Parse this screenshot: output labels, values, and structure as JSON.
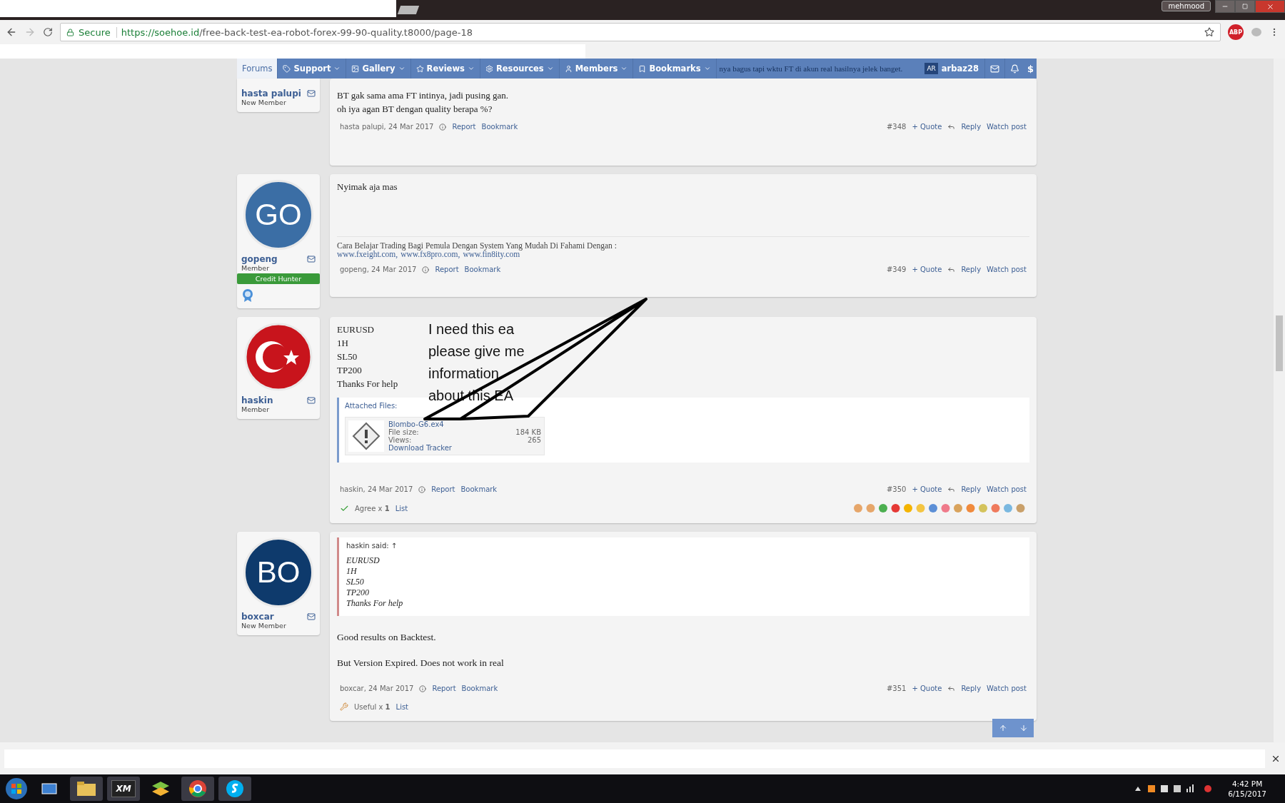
{
  "browser": {
    "profile": "mehmood",
    "secure_label": "Secure",
    "url_host": "https://soehoe.id",
    "url_path": "/free-back-test-ea-robot-forex-99-90-quality.t8000/page-18",
    "abp_label": "ABP"
  },
  "nav": {
    "items": [
      {
        "label": "Forums",
        "selected": true,
        "dropdown": false
      },
      {
        "label": "Support",
        "selected": false,
        "dropdown": true
      },
      {
        "label": "Gallery",
        "selected": false,
        "dropdown": true
      },
      {
        "label": "Reviews",
        "selected": false,
        "dropdown": true
      },
      {
        "label": "Resources",
        "selected": false,
        "dropdown": true
      },
      {
        "label": "Members",
        "selected": false,
        "dropdown": true
      },
      {
        "label": "Bookmarks",
        "selected": false,
        "dropdown": true
      }
    ],
    "behind_text": "nya bagus tapi wktu FT di akun real hasilnya jelek banget.",
    "user_initials": "AR",
    "user_name": "arbaz28",
    "cut_label": "$"
  },
  "posts": [
    {
      "author": "hasta palupi",
      "title": "New Member",
      "body": [
        "BT gak sama ama FT intinya, jadi pusing gan.",
        "oh iya agan BT dengan quality berapa %?"
      ],
      "meta": {
        "byline": "hasta palupi, 24 Mar 2017",
        "report": "Report",
        "bookmark": "Bookmark",
        "number": "#348",
        "quote": "+ Quote",
        "reply": "Reply",
        "watch": "Watch post"
      }
    },
    {
      "author": "gopeng",
      "title": "Member",
      "avatar": {
        "kind": "initials",
        "initials": "GO",
        "color": "#3b6ea5"
      },
      "badge": "Credit Hunter",
      "trophy": true,
      "body": [
        "Nyimak aja mas"
      ],
      "signature": {
        "text": "Cara Belajar Trading Bagi Pemula Dengan System Yang Mudah Di Fahami Dengan :",
        "links": [
          "www.fxeight.com,",
          "www.fx8pro.com,",
          "www.fin8ity.com"
        ]
      },
      "meta": {
        "byline": "gopeng, 24 Mar 2017",
        "report": "Report",
        "bookmark": "Bookmark",
        "number": "#349",
        "quote": "+ Quote",
        "reply": "Reply",
        "watch": "Watch post"
      }
    },
    {
      "author": "haskin",
      "title": "Member",
      "avatar": {
        "kind": "flag"
      },
      "body": [
        "EURUSD",
        "1H",
        "SL50",
        "TP200",
        "Thanks For help"
      ],
      "attachment": {
        "label": "Attached Files:",
        "name": "Blombo-G6.ex4",
        "size_label": "File size:",
        "size": "184 KB",
        "views_label": "Views:",
        "views": "265",
        "tracker": "Download Tracker"
      },
      "meta": {
        "byline": "haskin, 24 Mar 2017",
        "report": "Report",
        "bookmark": "Bookmark",
        "number": "#350",
        "quote": "+ Quote",
        "reply": "Reply",
        "watch": "Watch post"
      },
      "reaction": {
        "kind": "agree",
        "text": "Agree x **1**",
        "list": "List",
        "picker": true
      }
    },
    {
      "author": "boxcar",
      "title": "New Member",
      "avatar": {
        "kind": "initials",
        "initials": "BO",
        "color": "#0e3a6c"
      },
      "quote": {
        "header": "haskin said: ↑",
        "lines": [
          "EURUSD",
          "1H",
          "SL50",
          "TP200",
          "Thanks For help"
        ]
      },
      "paragraphs": [
        "Good results on Backtest.",
        "But Version Expired. Does not work in real"
      ],
      "meta": {
        "byline": "boxcar, 24 Mar 2017",
        "report": "Report",
        "bookmark": "Bookmark",
        "number": "#351",
        "quote": "+ Quote",
        "reply": "Reply",
        "watch": "Watch post"
      },
      "reaction": {
        "kind": "useful",
        "text": "Useful x **1**",
        "list": "List"
      }
    }
  ],
  "annotation": {
    "lines": [
      "I need this ea",
      "please give me",
      "information",
      "about this EA"
    ]
  },
  "taskbar": {
    "xm_label": "XM",
    "time": "4:42 PM",
    "date": "6/15/2017"
  }
}
